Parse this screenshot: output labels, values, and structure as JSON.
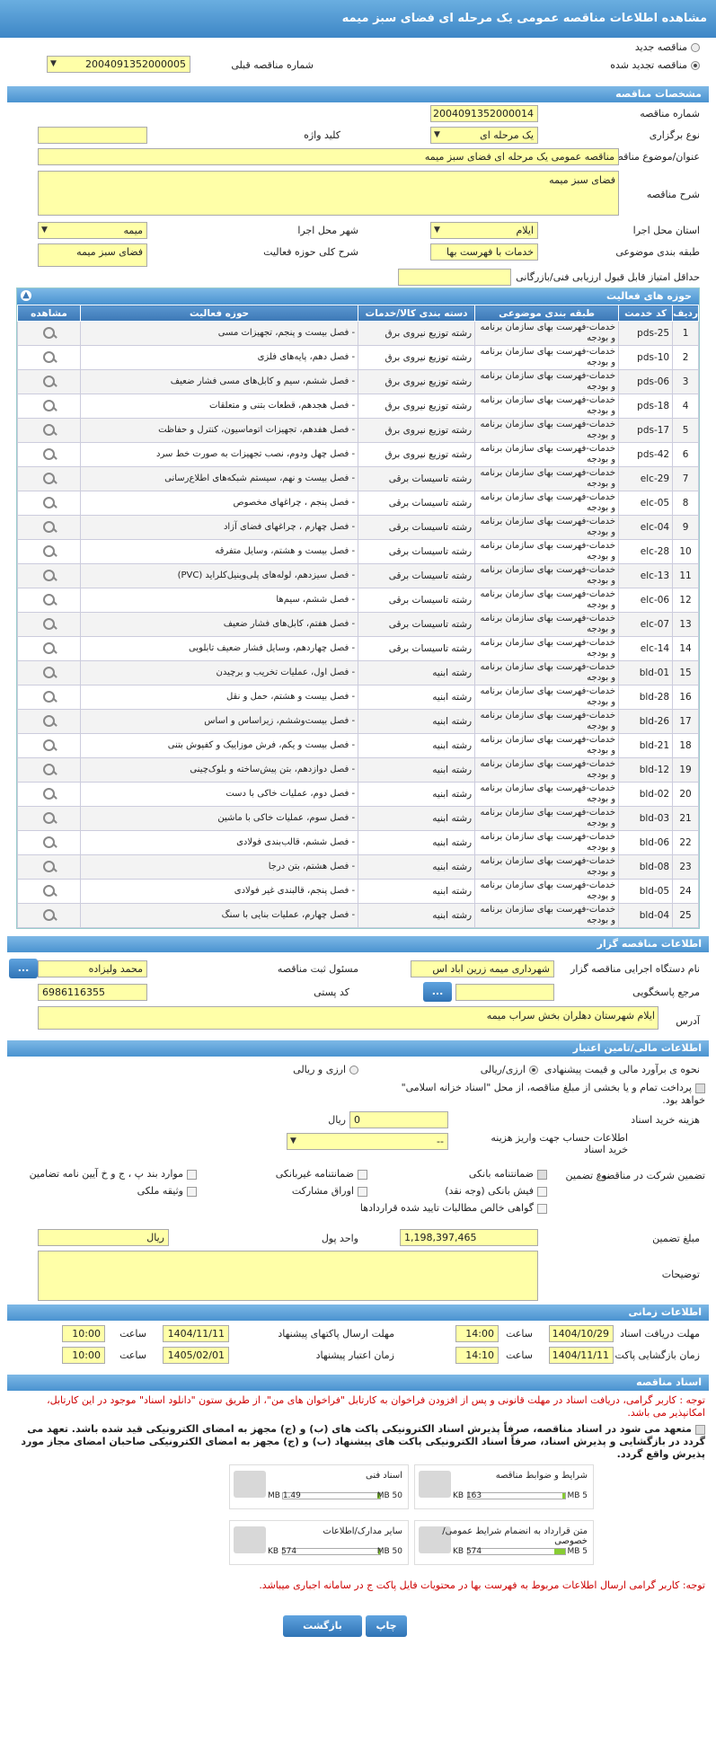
{
  "page": {
    "title": "مشاهده اطلاعات مناقصه عمومی یک مرحله ای فضای سبز میمه"
  },
  "top": {
    "new_label": "مناقصه جدید",
    "renewed_label": "مناقصه تجدید شده",
    "prev_label": "شماره مناقصه قبلی",
    "prev_value": "2004091352000005"
  },
  "specs": {
    "header": "مشخصات مناقصه",
    "number_label": "شماره مناقصه",
    "number_value": "2004091352000014",
    "type_label": "نوع برگزاری",
    "type_value": "یک مرحله ای",
    "keyword_label": "کلید واژه",
    "keyword_value": "",
    "subject_label": "عنوان/موضوع مناقصه",
    "subject_value": "مناقصه عمومی یک مرحله ای فضای سبز میمه",
    "desc_label": "شرح مناقصه",
    "desc_value": "فضای سبز میمه",
    "province_label": "استان محل اجرا",
    "province_value": "ایلام",
    "city_label": "شهر محل اجرا",
    "city_value": "میمه",
    "category_label": "طبقه بندی موضوعی",
    "category_value": "خدمات با فهرست بها",
    "activity_label": "شرح کلی حوزه فعالیت",
    "activity_value": "فضای سبز میمه",
    "score_label": "حداقل امتیاز قابل قبول ارزیابی فنی/بازرگانی",
    "score_value": ""
  },
  "activities": {
    "header": "حوزه های فعالیت",
    "cols": [
      "ردیف",
      "کد خدمت",
      "طبقه بندی موضوعی",
      "دسته بندی کالا/خدمات",
      "حوزه فعالیت",
      "مشاهده"
    ],
    "rows": [
      [
        "1",
        "pds-25",
        "خدمات-فهرست بهای سازمان برنامه و بودجه",
        "رشته توزیع نیروی برق",
        "- فصل بیست و پنجم، تجهیزات مسی"
      ],
      [
        "2",
        "pds-10",
        "خدمات-فهرست بهای سازمان برنامه و بودجه",
        "رشته توزیع نیروی برق",
        "- فصل دهم، پایه‌های فلزی"
      ],
      [
        "3",
        "pds-06",
        "خدمات-فهرست بهای سازمان برنامه و بودجه",
        "رشته توزیع نیروی برق",
        "- فصل ششم، سیم و کابل‌های مسی فشار ضعیف"
      ],
      [
        "4",
        "pds-18",
        "خدمات-فهرست بهای سازمان برنامه و بودجه",
        "رشته توزیع نیروی برق",
        "- فصل هجدهم، قطعات بتنی و متعلقات"
      ],
      [
        "5",
        "pds-17",
        "خدمات-فهرست بهای سازمان برنامه و بودجه",
        "رشته توزیع نیروی برق",
        "- فصل هفدهم، تجهیزات اتوماسیون، کنترل و حفاظت"
      ],
      [
        "6",
        "pds-42",
        "خدمات-فهرست بهای سازمان برنامه و بودجه",
        "رشته توزیع نیروی برق",
        "- فصل چهل ودوم، نصب تجهیزات به صورت خط سرد"
      ],
      [
        "7",
        "elc-29",
        "خدمات-فهرست بهای سازمان برنامه و بودجه",
        "رشته تاسیسات برقی",
        "- فصل بیست و نهم، سیستم شبکه‌های اطلاع‌رسانی"
      ],
      [
        "8",
        "elc-05",
        "خدمات-فهرست بهای سازمان برنامه و بودجه",
        "رشته تاسیسات برقی",
        "- فصل پنجم ، چراغهای مخصوص"
      ],
      [
        "9",
        "elc-04",
        "خدمات-فهرست بهای سازمان برنامه و بودجه",
        "رشته تاسیسات برقی",
        "- فصل چهارم ، چراغهای فضای آزاد"
      ],
      [
        "10",
        "elc-28",
        "خدمات-فهرست بهای سازمان برنامه و بودجه",
        "رشته تاسیسات برقی",
        "- فصل بیست و هشتم، وسایل متفرقه"
      ],
      [
        "11",
        "elc-13",
        "خدمات-فهرست بهای سازمان برنامه و بودجه",
        "رشته تاسیسات برقی",
        "- فصل سیزدهم، لوله‌های پلی‌وینیل‌کلراید (PVC)"
      ],
      [
        "12",
        "elc-06",
        "خدمات-فهرست بهای سازمان برنامه و بودجه",
        "رشته تاسیسات برقی",
        "- فصل ششم، سیم‌ها"
      ],
      [
        "13",
        "elc-07",
        "خدمات-فهرست بهای سازمان برنامه و بودجه",
        "رشته تاسیسات برقی",
        "- فصل هفتم، کابل‌های فشار ضعیف"
      ],
      [
        "14",
        "elc-14",
        "خدمات-فهرست بهای سازمان برنامه و بودجه",
        "رشته تاسیسات برقی",
        "- فصل چهاردهم، وسایل فشار ضعیف تابلویی"
      ],
      [
        "15",
        "bld-01",
        "خدمات-فهرست بهای سازمان برنامه و بودجه",
        "رشته ابنیه",
        "- فصل اول، عملیات تخریب و برچیدن"
      ],
      [
        "16",
        "bld-28",
        "خدمات-فهرست بهای سازمان برنامه و بودجه",
        "رشته ابنیه",
        "- فصل بیست و هشتم، حمل و نقل"
      ],
      [
        "17",
        "bld-26",
        "خدمات-فهرست بهای سازمان برنامه و بودجه",
        "رشته ابنیه",
        "- فصل بیست‌وششم، زیراساس و اساس"
      ],
      [
        "18",
        "bld-21",
        "خدمات-فهرست بهای سازمان برنامه و بودجه",
        "رشته ابنیه",
        "- فصل بیست و یکم، فرش موزاییک و کفپوش بتنی"
      ],
      [
        "19",
        "bld-12",
        "خدمات-فهرست بهای سازمان برنامه و بودجه",
        "رشته ابنیه",
        "- فصل دوازدهم، بتن پیش‌ساخته و بلوک‌چینی"
      ],
      [
        "20",
        "bld-02",
        "خدمات-فهرست بهای سازمان برنامه و بودجه",
        "رشته ابنیه",
        "- فصل دوم، عملیات خاکی با دست"
      ],
      [
        "21",
        "bld-03",
        "خدمات-فهرست بهای سازمان برنامه و بودجه",
        "رشته ابنیه",
        "- فصل سوم، عملیات خاکی با ماشین"
      ],
      [
        "22",
        "bld-06",
        "خدمات-فهرست بهای سازمان برنامه و بودجه",
        "رشته ابنیه",
        "- فصل ششم، قالب‌بندی فولادی"
      ],
      [
        "23",
        "bld-08",
        "خدمات-فهرست بهای سازمان برنامه و بودجه",
        "رشته ابنیه",
        "- فصل هشتم، بتن درجا"
      ],
      [
        "24",
        "bld-05",
        "خدمات-فهرست بهای سازمان برنامه و بودجه",
        "رشته ابنیه",
        "- فصل پنجم، قالبندی غیر فولادی"
      ],
      [
        "25",
        "bld-04",
        "خدمات-فهرست بهای سازمان برنامه و بودجه",
        "رشته ابنیه",
        "- فصل چهارم، عملیات بنایی با سنگ"
      ]
    ]
  },
  "organizer": {
    "header": "اطلاعات مناقصه گزار",
    "org_label": "نام دستگاه اجرایی مناقصه گزار",
    "org_value": "شهرداری میمه زرین اباد اس",
    "resp_label": "مسئول ثبت مناقصه",
    "resp_value": "محمد ولیزاده",
    "ref_label": "مرجع پاسخگویی",
    "ref_value": "",
    "postal_label": "کد پستی",
    "postal_value": "6986116355",
    "addr_label": "آدرس",
    "addr_value": "ایلام شهرستان دهلران بخش سراب میمه",
    "more": "..."
  },
  "finance": {
    "header": "اطلاعات مالی/تامین اعتبار",
    "estimate_label": "نحوه ی برآورد مالی و قیمت پیشنهادی",
    "opt1": "ارزی/ریالی",
    "opt2": "ارزی و ریالی",
    "pay_text": "پرداخت تمام و یا بخشی از مبلغ مناقصه، از محل \"اسناد خزانه اسلامی\" خواهد بود.",
    "docfee_label": "هزینه خرید اسناد",
    "docfee_value": "0",
    "docfee_unit": "ریال",
    "account_label": "اطلاعات حساب جهت واریز هزینه خرید اسناد",
    "account_value": "--",
    "guarantee_label": "تضمین شرکت در مناقصه:",
    "gtype_label": "نوع تضمین",
    "g1": "ضمانتنامه بانکی",
    "g2": "ضمانتنامه غیربانکی",
    "g3": "موارد بند پ ، ج و خ آیین نامه تضامین",
    "g4": "فیش بانکی (وجه نقد)",
    "g5": "اوراق مشارکت",
    "g6": "وثیقه ملکی",
    "g7": "گواهی خالص مطالبات تایید شده قراردادها",
    "amount_label": "مبلغ تضمین",
    "amount_value": "1,198,397,465",
    "unit_label": "واحد پول",
    "unit_value": "ریال",
    "notes_label": "توضیحات",
    "notes_value": ""
  },
  "timing": {
    "header": "اطلاعات زمانی",
    "recv_label": "مهلت دریافت اسناد",
    "recv_date": "1404/10/29",
    "recv_time": "14:00",
    "send_label": "مهلت ارسال پاکتهای پیشنهاد",
    "send_date": "1404/11/11",
    "send_time": "10:00",
    "open_label": "زمان بازگشایی پاکت ها",
    "open_date": "1404/11/11",
    "open_time": "14:10",
    "valid_label": "زمان اعتبار پیشنهاد",
    "valid_date": "1405/02/01",
    "valid_time": "10:00",
    "time_label": "ساعت"
  },
  "docs": {
    "header": "اسناد مناقصه",
    "note1": "توجه : کاربر گرامی، دریافت اسناد در مهلت قانونی و پس از افزودن فراخوان به کارتابل \"فراخوان های من\"، از طریق ستون \"دانلود اسناد\" موجود در این کارتابل، امکانپذیر می باشد.",
    "note2": "متعهد می شود در اسناد مناقصه، صرفاً پذیرش اسناد الکترونیکی پاکت های (ب) و (ج) مجهز به امضای الکترونیکی قید شده باشد. تعهد می گردد در بازگشایی و پذیرش اسناد، صرفاً اسناد الکترونیکی پاکت های پیشنهاد (ب) و (ج) مجهز به امضای الکترونیکی صاحبان امضای مجاز مورد پذیرش واقع گردد.",
    "cards": [
      {
        "title": "شرایط و ضوابط مناقصه",
        "cur": "163 KB",
        "max": "5 MB",
        "fill": 0.03
      },
      {
        "title": "اسناد فنی",
        "cur": "1.49 MB",
        "max": "50 MB",
        "fill": 0.03
      },
      {
        "title": "متن قرارداد به انضمام شرایط عمومی/خصوصی",
        "cur": "574 KB",
        "max": "5 MB",
        "fill": 0.11
      },
      {
        "title": "سایر مدارک/اطلاعات",
        "cur": "574 KB",
        "max": "50 MB",
        "fill": 0.01
      }
    ],
    "note3": "توجه: کاربر گرامی ارسال اطلاعات مربوط به فهرست بها در محتویات فایل پاکت ج در سامانه اجباری میباشد."
  },
  "buttons": {
    "print": "چاپ",
    "back": "بازگشت"
  }
}
